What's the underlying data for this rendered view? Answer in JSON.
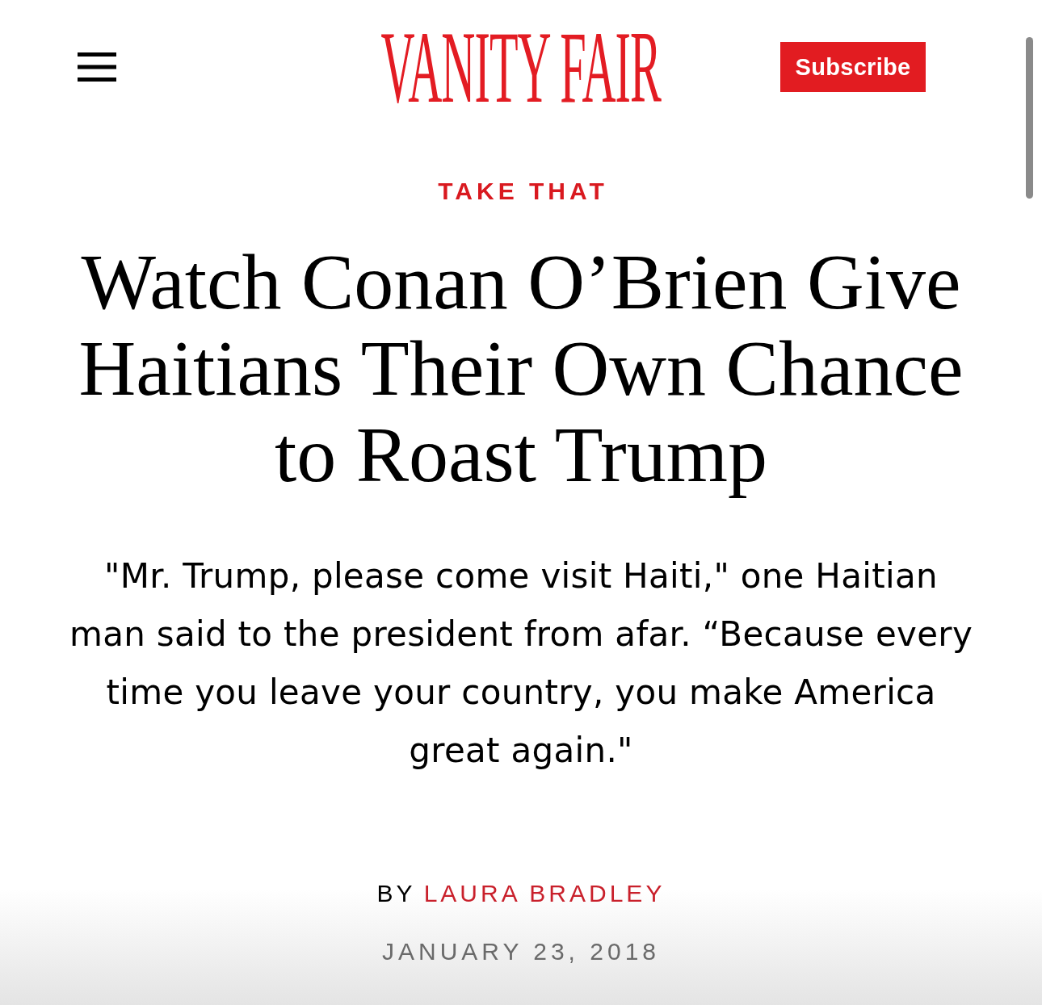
{
  "header": {
    "logo": "VANITY FAIR",
    "subscribe_button": "Subscribe"
  },
  "article": {
    "rubric": "TAKE THAT",
    "headline": "Watch Conan O’Brien Give Haitians Their Own Chance to Roast Trump",
    "dek": "\"Mr. Trump, please come visit Haiti,\" one Haitian man said to the president from afar. “Because every time you leave your country, you make America great again.\"",
    "byline": {
      "prefix": "BY",
      "author": "LAURA BRADLEY"
    },
    "date": "JANUARY 23, 2018"
  }
}
